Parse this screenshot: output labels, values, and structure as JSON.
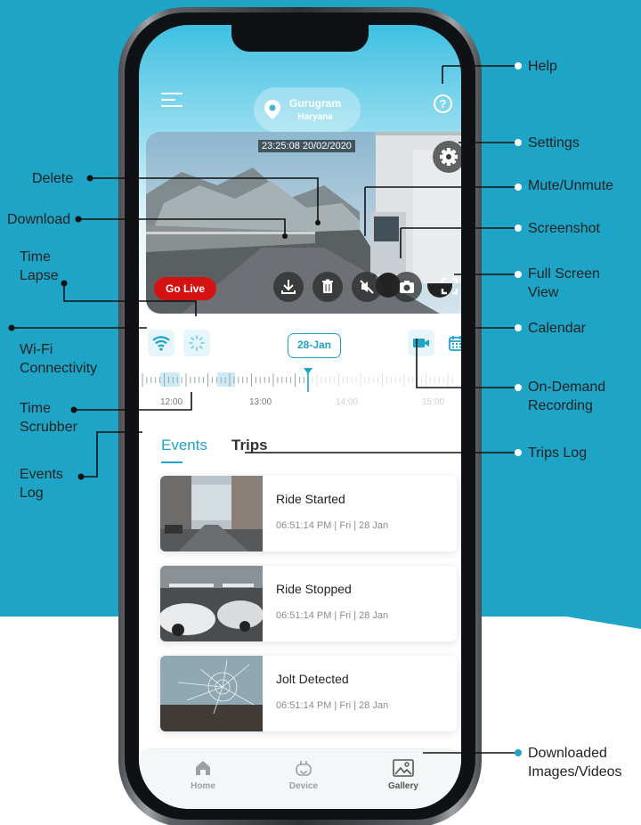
{
  "header": {
    "location_city": "Gurugram",
    "location_state": "Haryana",
    "help_label": "?"
  },
  "video": {
    "timestamp": "23:25:08  20/02/2020",
    "go_live_label": "Go Live"
  },
  "controls": {
    "date_label": "28-Jan"
  },
  "timeline": {
    "tick_labels": [
      "12:00",
      "13:00",
      "14:00",
      "15:00"
    ]
  },
  "tabs": [
    {
      "label": "Events",
      "active": true
    },
    {
      "label": "Trips",
      "active": false
    }
  ],
  "events": [
    {
      "title": "Ride Started",
      "time": "06:51:14 PM | Fri | 28 Jan"
    },
    {
      "title": "Ride Stopped",
      "time": "06:51:14 PM | Fri | 28 Jan"
    },
    {
      "title": "Jolt Detected",
      "time": "06:51:14 PM | Fri | 28 Jan"
    }
  ],
  "bottom_nav": [
    {
      "label": "Home",
      "icon": "home-icon"
    },
    {
      "label": "Device",
      "icon": "device-icon"
    },
    {
      "label": "Gallery",
      "icon": "gallery-icon",
      "active": true
    }
  ],
  "callouts": {
    "help": "Help",
    "settings": "Settings",
    "mute": "Mute/Unmute",
    "screenshot": "Screenshot",
    "fullscreen_1": "Full Screen",
    "fullscreen_2": "View",
    "calendar": "Calendar",
    "on_demand_1": "On-Demand",
    "on_demand_2": "Recording",
    "trips_log": "Trips Log",
    "downloaded_1": "Downloaded",
    "downloaded_2": "Images/Videos",
    "delete": "Delete",
    "download": "Download",
    "time_lapse_1": "Time",
    "time_lapse_2": "Lapse",
    "wifi_1": "Wi-Fi",
    "wifi_2": "Connectivity",
    "scrubber_1": "Time",
    "scrubber_2": "Scrubber",
    "events_log_1": "Events",
    "events_log_2": "Log"
  },
  "colors": {
    "brand": "#1ea4c6",
    "live_red": "#d51212",
    "background_blue": "#1ea4c6"
  }
}
